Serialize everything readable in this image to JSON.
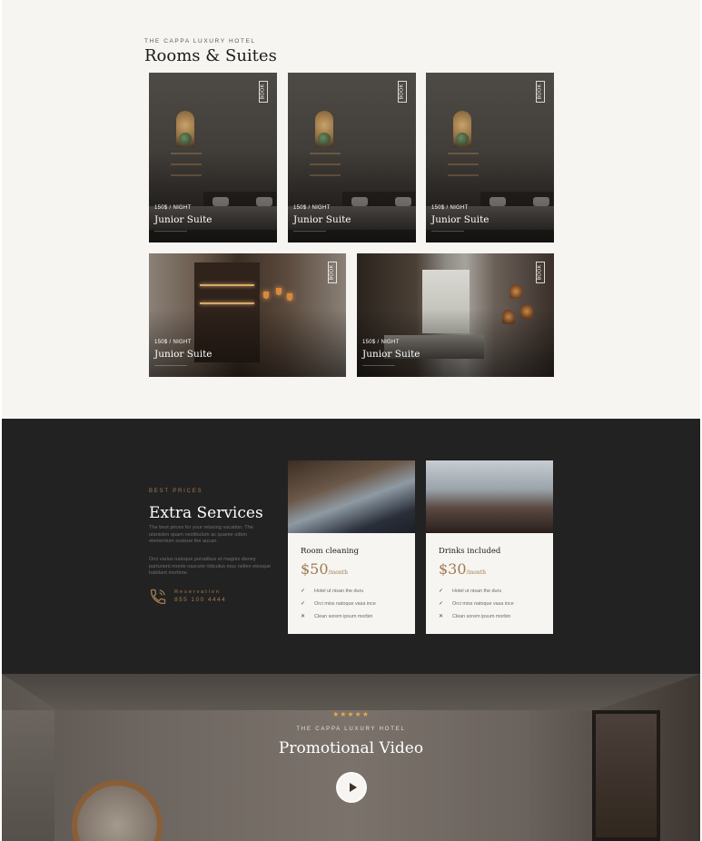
{
  "rooms": {
    "kicker": "THE CAPPA LUXURY HOTEL",
    "title": "Rooms & Suites",
    "cards": [
      {
        "book_label": "BOOK",
        "price": "150$ / NIGHT",
        "name": "Junior Suite"
      },
      {
        "book_label": "BOOK",
        "price": "150$ / NIGHT",
        "name": "Junior Suite"
      },
      {
        "book_label": "BOOK",
        "price": "150$ / NIGHT",
        "name": "Junior Suite"
      },
      {
        "book_label": "BOOK",
        "price": "150$ / NIGHT",
        "name": "Junior Suite"
      },
      {
        "book_label": "BOOK",
        "price": "150$ / NIGHT",
        "name": "Junior Suite"
      }
    ]
  },
  "services": {
    "kicker": "BEST PRICES",
    "title": "Extra Services",
    "desc1": "The best prices for your relaxing vacation. The utanislen quam nestibulum ac quame odion elementum sceisue the aucan.",
    "desc2": "Orci varius natoque penatibus et magnis disney parturient monte nascete ridiculus mus nellen etesque habitant morbine.",
    "reservation_label": "Reservation",
    "reservation_number": "855 100 4444",
    "items": [
      {
        "name": "Room cleaning",
        "price": "$50",
        "unit": "/month",
        "features": [
          {
            "mark": "✓",
            "text": "Hotel ut nisan the duru"
          },
          {
            "mark": "✓",
            "text": "Orci miss natoque vasa ince"
          },
          {
            "mark": "✕",
            "text": "Clean sorem ipsum morbin"
          }
        ]
      },
      {
        "name": "Drinks included",
        "price": "$30",
        "unit": "/month",
        "features": [
          {
            "mark": "✓",
            "text": "Hotel ut nisan the duru"
          },
          {
            "mark": "✓",
            "text": "Orci miss natoque vasa ince"
          },
          {
            "mark": "✕",
            "text": "Clean sorem ipsum morbin"
          }
        ]
      }
    ]
  },
  "video": {
    "stars": "★★★★★",
    "kicker": "THE CAPPA LUXURY HOTEL",
    "title": "Promotional Video",
    "play_icon": "play-icon"
  },
  "colors": {
    "accent": "#a07a52",
    "dark_bg": "#222222",
    "light_bg": "#f7f5f1",
    "star": "#e8a848"
  }
}
